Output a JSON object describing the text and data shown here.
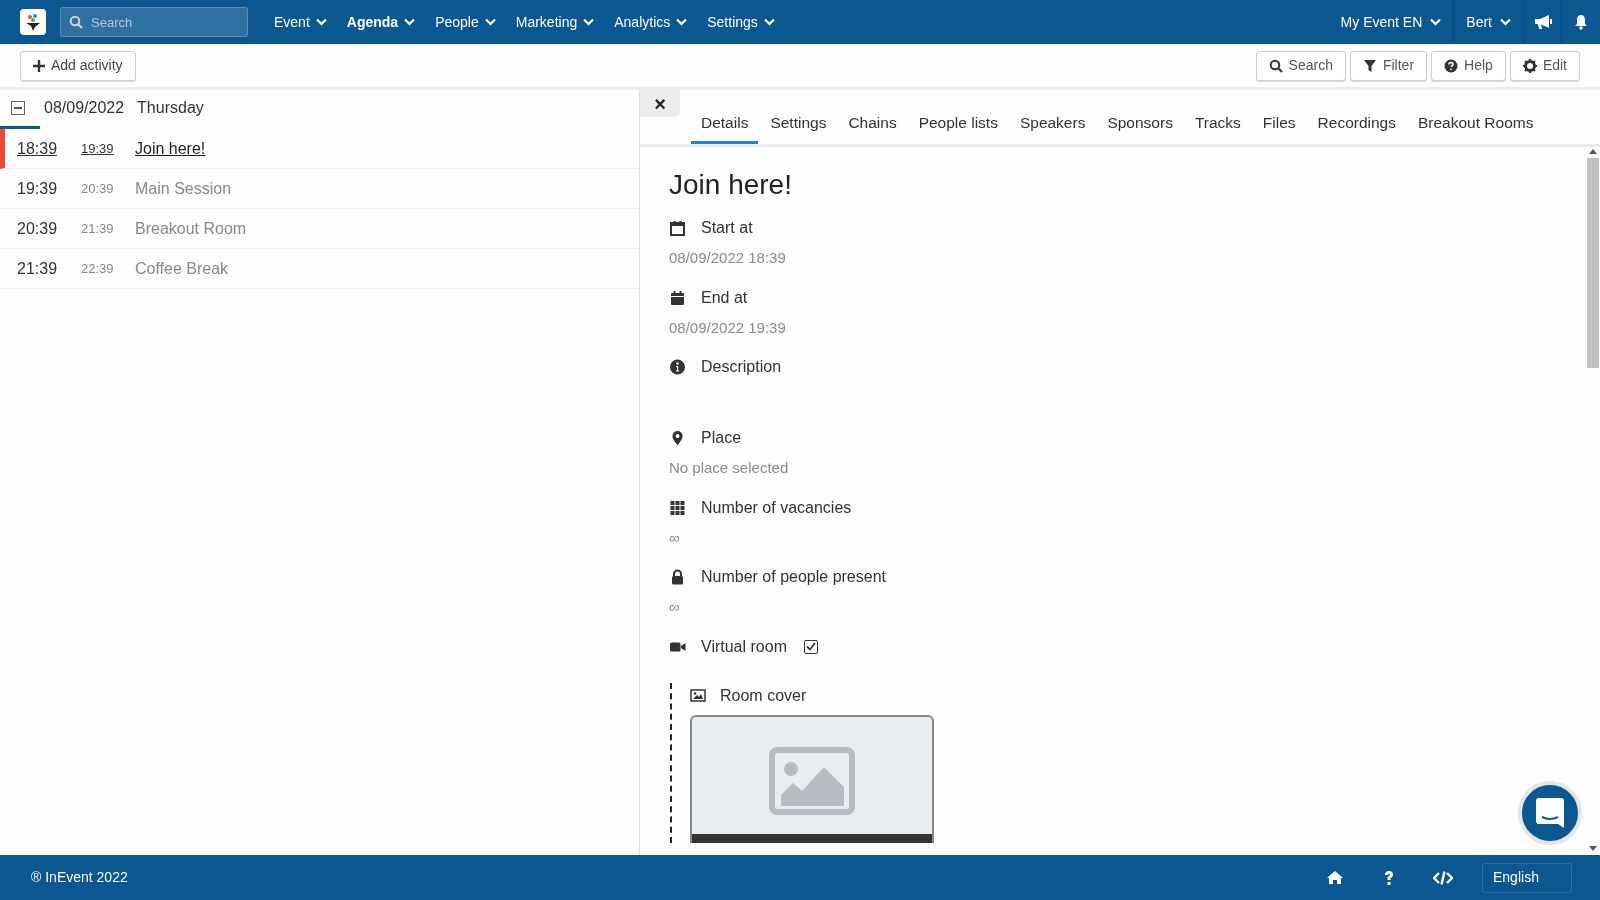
{
  "top_bar": {
    "search": {
      "placeholder": "Search"
    },
    "menu": [
      {
        "label": "Event",
        "selected": false
      },
      {
        "label": "Agenda",
        "selected": true
      },
      {
        "label": "People",
        "selected": false
      },
      {
        "label": "Marketing",
        "selected": false
      },
      {
        "label": "Analytics",
        "selected": false
      },
      {
        "label": "Settings",
        "selected": false
      }
    ],
    "event_menu": "My Event EN",
    "user_menu": "Bert"
  },
  "toolbar": {
    "add_button": "Add activity",
    "buttons": [
      {
        "kind": "search",
        "label": "Search"
      },
      {
        "kind": "filter",
        "label": "Filter"
      },
      {
        "kind": "help",
        "label": "Help"
      },
      {
        "kind": "edit",
        "label": "Edit"
      }
    ]
  },
  "agenda": {
    "date": "08/09/2022",
    "weekday": "Thursday",
    "expanded": true,
    "rows": [
      {
        "start": "18:39",
        "end": "19:39",
        "title": "Join here!",
        "selected": true
      },
      {
        "start": "19:39",
        "end": "20:39",
        "title": "Main Session",
        "selected": false
      },
      {
        "start": "20:39",
        "end": "21:39",
        "title": "Breakout Room",
        "selected": false
      },
      {
        "start": "21:39",
        "end": "22:39",
        "title": "Coffee Break",
        "selected": false
      }
    ]
  },
  "detail": {
    "close": "×",
    "tabs": [
      {
        "label": "Details",
        "selected": true
      },
      {
        "label": "Settings",
        "selected": false
      },
      {
        "label": "Chains",
        "selected": false
      },
      {
        "label": "People lists",
        "selected": false
      },
      {
        "label": "Speakers",
        "selected": false
      },
      {
        "label": "Sponsors",
        "selected": false
      },
      {
        "label": "Tracks",
        "selected": false
      },
      {
        "label": "Files",
        "selected": false
      },
      {
        "label": "Recordings",
        "selected": false
      },
      {
        "label": "Breakout Rooms",
        "selected": false
      }
    ],
    "title": "Join here!",
    "fields": [
      {
        "kind": "calendar",
        "label": "Start at",
        "value": "08/09/2022 18:39"
      },
      {
        "kind": "calendar-filled",
        "label": "End at",
        "value": "08/09/2022 19:39"
      },
      {
        "kind": "info",
        "label": "Description"
      },
      {
        "kind": "pin",
        "label": "Place",
        "value": "No place selected"
      },
      {
        "kind": "grid",
        "label": "Number of vacancies",
        "value": "∞"
      },
      {
        "kind": "lock",
        "label": "Number of people present",
        "value": "∞"
      },
      {
        "kind": "video",
        "label": "Virtual room",
        "checked": true
      }
    ],
    "room_cover": {
      "label": "Room cover"
    }
  },
  "footer": {
    "copyright": "® InEvent 2022",
    "language": "English"
  }
}
